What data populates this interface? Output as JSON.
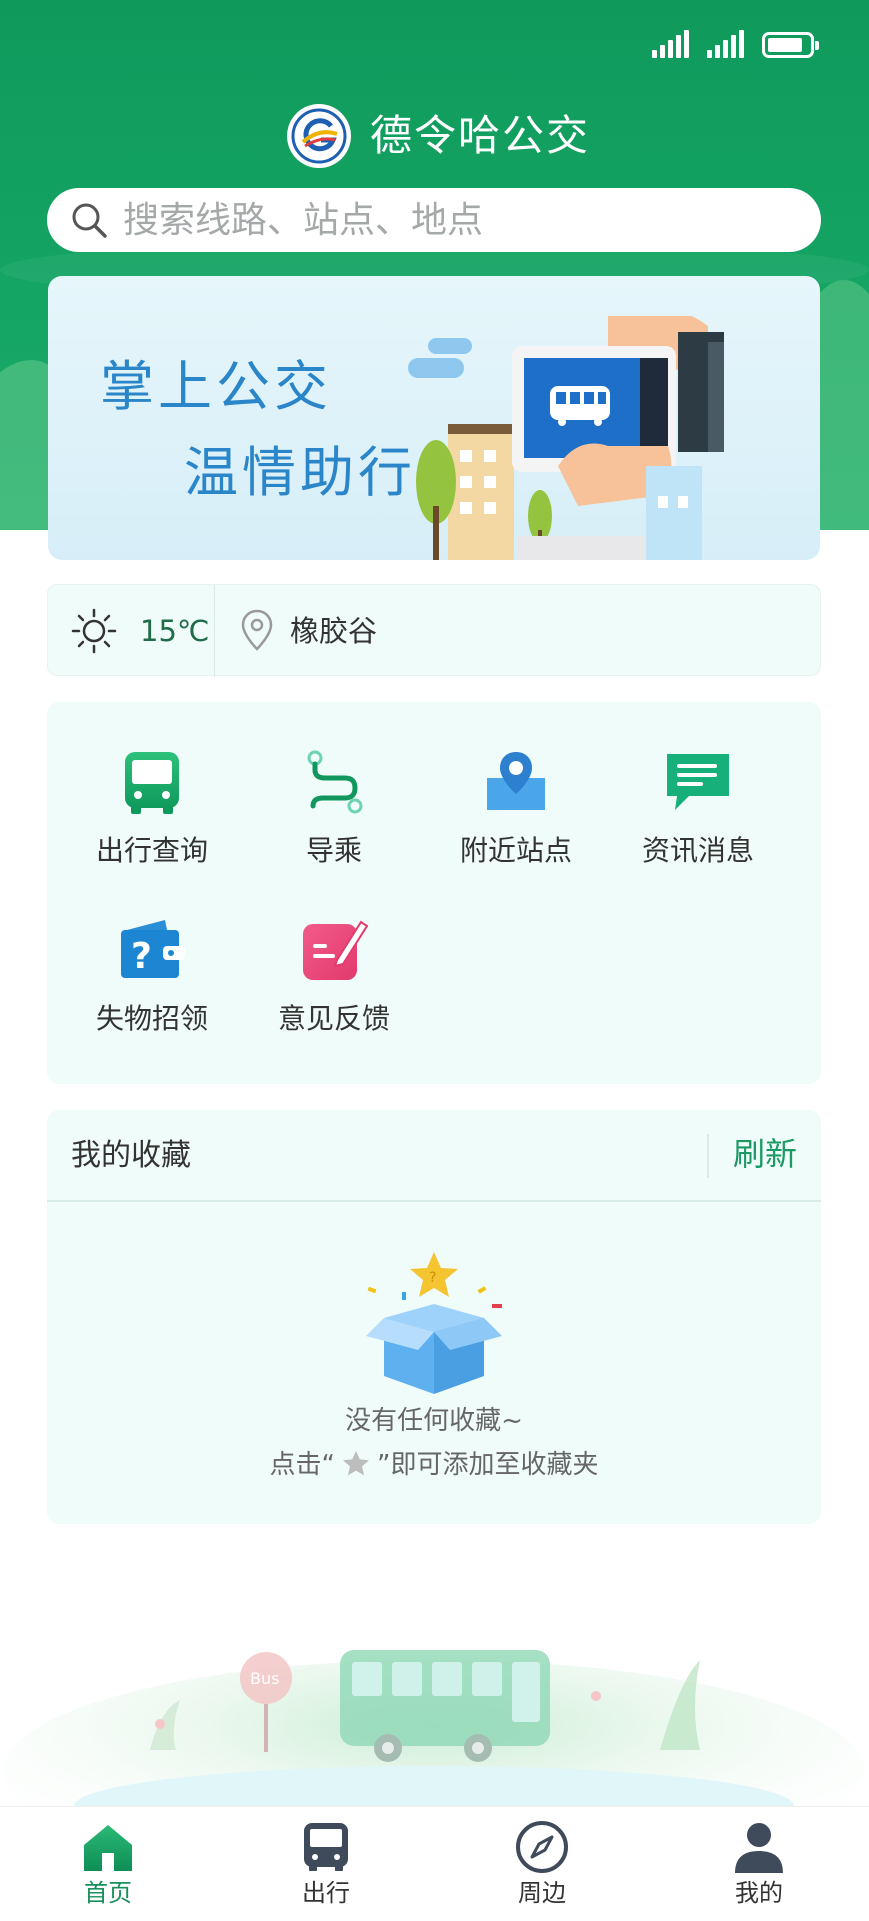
{
  "app": {
    "title": "德令哈公交"
  },
  "search": {
    "placeholder": "搜索线路、站点、地点"
  },
  "banner": {
    "line1": "掌上公交",
    "line2": "温情助行"
  },
  "weather": {
    "temperature": "15℃",
    "location": "橡胶谷",
    "icon": "sun-icon"
  },
  "menu": {
    "items": [
      {
        "label": "出行查询",
        "icon": "bus-icon"
      },
      {
        "label": "导乘",
        "icon": "route-icon"
      },
      {
        "label": "附近站点",
        "icon": "map-pin-icon"
      },
      {
        "label": "资讯消息",
        "icon": "message-icon"
      },
      {
        "label": "失物招领",
        "icon": "lost-found-icon"
      },
      {
        "label": "意见反馈",
        "icon": "feedback-icon"
      }
    ]
  },
  "favorites": {
    "title": "我的收藏",
    "refresh_label": "刷新",
    "empty_line1": "没有任何收藏~",
    "empty_line2_prefix": "点击“",
    "empty_line2_suffix": "”即可添加至收藏夹"
  },
  "tabbar": {
    "items": [
      {
        "label": "首页",
        "icon": "home-icon",
        "active": true
      },
      {
        "label": "出行",
        "icon": "bus-icon",
        "active": false
      },
      {
        "label": "周边",
        "icon": "compass-icon",
        "active": false
      },
      {
        "label": "我的",
        "icon": "user-icon",
        "active": false
      }
    ]
  },
  "colors": {
    "primary": "#14a463",
    "primary_dark": "#0f9a5c",
    "card_bg": "#f0fcfa",
    "banner_text": "#2a86c9",
    "active_tab": "#17915a"
  }
}
